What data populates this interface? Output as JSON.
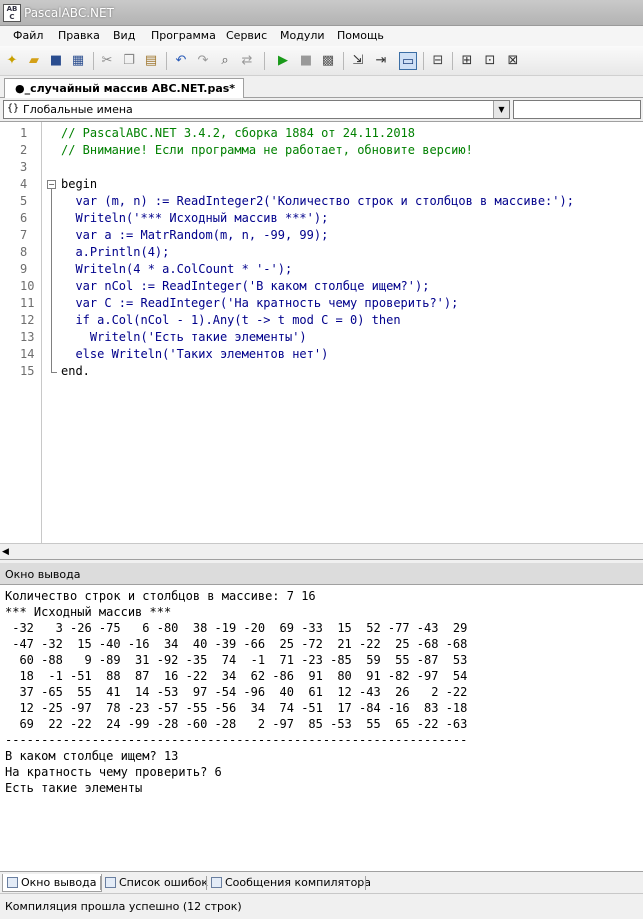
{
  "window": {
    "title": "PascalABC.NET"
  },
  "menu": [
    "Файл",
    "Правка",
    "Вид",
    "Программа",
    "Сервис",
    "Модули",
    "Помощь"
  ],
  "toolbar": {
    "buttons": [
      "new-file-icon",
      "open-folder-icon",
      "save-icon",
      "save-all-icon",
      "cut-icon",
      "copy-icon",
      "paste-icon",
      "undo-icon",
      "redo-icon",
      "find-icon",
      "replace-icon",
      "run-icon",
      "stop-icon",
      "compile-icon",
      "step-into-icon",
      "step-over-icon",
      "output-window-icon",
      "debug-icon",
      "format-icon",
      "sort-icon",
      "refactor-icon"
    ]
  },
  "tab": {
    "label": "●_случайный массив ABC.NET.pas*"
  },
  "scope": {
    "icon_text": "{}",
    "value": "Глобальные имена"
  },
  "editor": {
    "line_numbers": [
      "1",
      "2",
      "3",
      "4",
      "5",
      "6",
      "7",
      "8",
      "9",
      "10",
      "11",
      "12",
      "13",
      "14",
      "15"
    ],
    "lines": [
      "// PascalABC.NET 3.4.2, сборка 1884 от 24.11.2018",
      "// Внимание! Если программа не работает, обновите версию!",
      "",
      "begin",
      "  var (m, n) := ReadInteger2('Количество строк и столбцов в массиве:');",
      "  Writeln('*** Исходный массив ***');",
      "  var a := MatrRandom(m, n, -99, 99);",
      "  a.Println(4);",
      "  Writeln(4 * a.ColCount * '-');",
      "  var nCol := ReadInteger('В каком столбце ищем?');",
      "  var C := ReadInteger('На кратность чему проверить?');",
      "  if a.Col(nCol - 1).Any(t -> t mod C = 0) then",
      "    Writeln('Есть такие элементы')",
      "  else Writeln('Таких элементов нет')",
      "end."
    ]
  },
  "output_panel": {
    "title": "Окно вывода",
    "lines": [
      "Количество строк и столбцов в массиве: 7 16",
      "*** Исходный массив ***",
      " -32   3 -26 -75   6 -80  38 -19 -20  69 -33  15  52 -77 -43  29",
      " -47 -32  15 -40 -16  34  40 -39 -66  25 -72  21 -22  25 -68 -68",
      "  60 -88   9 -89  31 -92 -35  74  -1  71 -23 -85  59  55 -87  53",
      "  18  -1 -51  88  87  16 -22  34  62 -86  91  80  91 -82 -97  54",
      "  37 -65  55  41  14 -53  97 -54 -96  40  61  12 -43  26   2 -22",
      "  12 -25 -97  78 -23 -57 -55 -56  34  74 -51  17 -84 -16  83 -18",
      "  69  22 -22  24 -99 -28 -60 -28   2 -97  85 -53  55  65 -22 -63",
      "----------------------------------------------------------------",
      "В каком столбце ищем? 13",
      "На кратность чему проверить? 6",
      "Есть такие элементы"
    ]
  },
  "bottom_tabs": [
    "Окно вывода",
    "Список ошибок",
    "Сообщения компилятора"
  ],
  "status": {
    "text": "Компиляция прошла успешно (12 строк)"
  }
}
